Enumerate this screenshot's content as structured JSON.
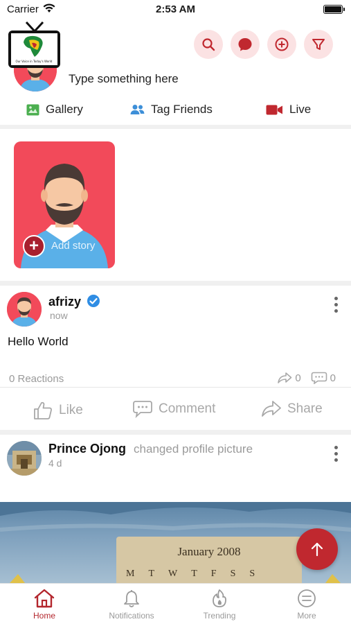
{
  "status_bar": {
    "carrier": "Carrier",
    "time": "2:53 AM"
  },
  "header": {
    "logo_text": "Our Voice in Today's World",
    "icons": [
      "search-icon",
      "messenger-icon",
      "add-circle-icon",
      "filter-icon"
    ]
  },
  "composer": {
    "placeholder": "Type something here",
    "actions": [
      {
        "label": "Gallery",
        "icon": "gallery-icon"
      },
      {
        "label": "Tag Friends",
        "icon": "tag-friends-icon"
      },
      {
        "label": "Live",
        "icon": "video-icon"
      }
    ]
  },
  "stories": {
    "add_label": "Add story",
    "plus": "+"
  },
  "post1": {
    "author": "afrizy",
    "time": "now",
    "text": "Hello World",
    "reactions": "0 Reactions",
    "shares": "0",
    "comments": "0",
    "actions": {
      "like": "Like",
      "comment": "Comment",
      "share": "Share"
    }
  },
  "post2": {
    "author": "Prince Ojong",
    "activity": "changed profile picture",
    "time": "4 d",
    "calendar_title": "January 2008",
    "calendar_days": [
      "M",
      "T",
      "W",
      "T",
      "F",
      "S",
      "S"
    ]
  },
  "tabs": [
    {
      "label": "Home",
      "icon": "home-icon",
      "active": true
    },
    {
      "label": "Notifications",
      "icon": "bell-icon",
      "active": false
    },
    {
      "label": "Trending",
      "icon": "flame-icon",
      "active": false
    },
    {
      "label": "More",
      "icon": "more-icon",
      "active": false
    }
  ],
  "colors": {
    "accent": "#b3262d",
    "icon_bg": "#fbe2e3",
    "story_bg": "#f24a5a"
  }
}
